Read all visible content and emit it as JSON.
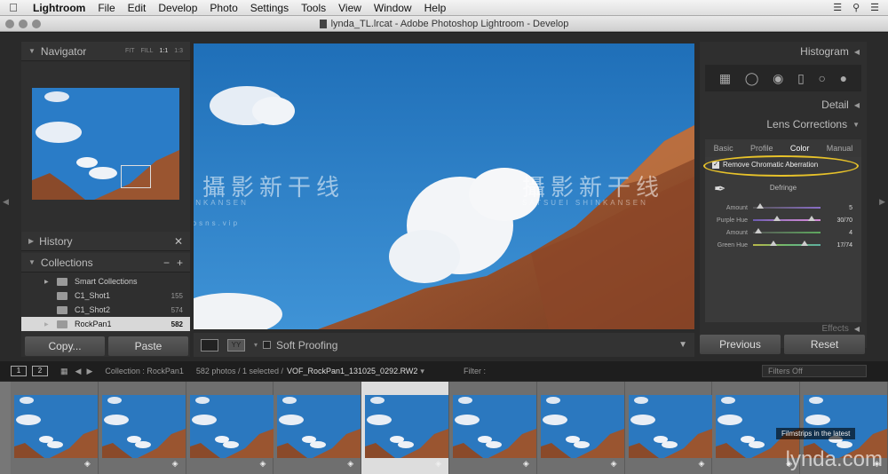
{
  "menubar": {
    "app": "Lightroom",
    "items": [
      "File",
      "Edit",
      "Develop",
      "Photo",
      "Settings",
      "Tools",
      "View",
      "Window",
      "Help"
    ]
  },
  "titlebar": {
    "title": "lynda_TL.lrcat - Adobe Photoshop Lightroom - Develop"
  },
  "navigator": {
    "title": "Navigator",
    "modes": [
      "FIT",
      "FILL",
      "1:1",
      "1:3"
    ]
  },
  "history": {
    "title": "History"
  },
  "collections": {
    "title": "Collections",
    "items": [
      {
        "label": "Smart Collections",
        "count": ""
      },
      {
        "label": "C1_Shot1",
        "count": "155"
      },
      {
        "label": "C1_Shot2",
        "count": "574"
      },
      {
        "label": "RockPan1",
        "count": "582"
      }
    ]
  },
  "left_buttons": {
    "copy": "Copy...",
    "paste": "Paste"
  },
  "toolbar": {
    "soft_proofing": "Soft Proofing",
    "yy": "YY"
  },
  "right_panel": {
    "histogram": "Histogram",
    "detail": "Detail",
    "lens_corrections": "Lens Corrections",
    "tabs": [
      "Basic",
      "Profile",
      "Color",
      "Manual"
    ],
    "active_tab": "Color",
    "remove_ca": "Remove Chromatic Aberration",
    "defringe": "Defringe",
    "sliders": [
      {
        "label": "Amount",
        "value": "5",
        "pos": 0.1,
        "color": "#8a6ec8"
      },
      {
        "label": "Purple Hue",
        "value": "30/70",
        "pos": 0.35,
        "color": "#9a62c8"
      },
      {
        "label": "Amount",
        "value": "4",
        "pos": 0.08,
        "color": "#5fa85f"
      },
      {
        "label": "Green Hue",
        "value": "17/74",
        "pos": 0.3,
        "color": "#6fb86f"
      }
    ],
    "effects": "Effects",
    "previous": "Previous",
    "reset": "Reset"
  },
  "filmbar": {
    "view1": "1",
    "view2": "2",
    "collection": "Collection : RockPan1",
    "count": "582 photos / 1 selected /",
    "filename": "VOF_RockPan1_131025_0292.RW2",
    "filter": "Filter :",
    "filters_off": "Filters Off"
  },
  "overlay": {
    "cn": "攝影新干线",
    "en": "SATSUEI SHINKANSEN",
    "url": "www.photosns.vip"
  },
  "toast": "Filmstrips in the latest",
  "watermark": "lynda.com",
  "colors": {
    "selection_ring": "#e7c22a",
    "sky": "#2a7cc7"
  }
}
